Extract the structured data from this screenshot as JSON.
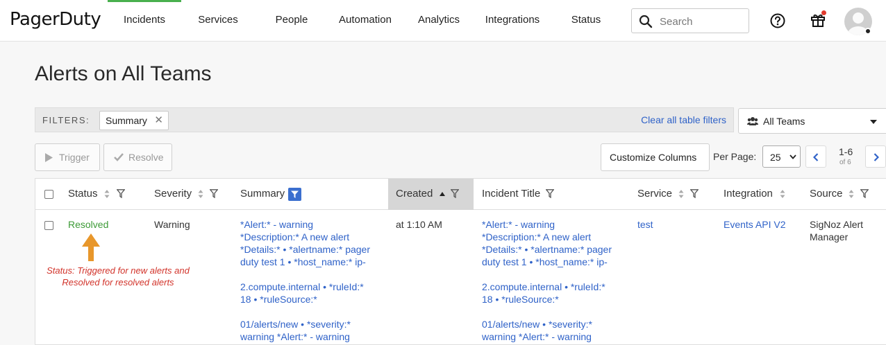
{
  "brand": "PagerDuty",
  "nav": {
    "items": [
      "Incidents",
      "Services",
      "People",
      "Automation",
      "Analytics",
      "Integrations",
      "Status"
    ],
    "active": "Incidents"
  },
  "search": {
    "placeholder": "Search"
  },
  "page_title": "Alerts on All Teams",
  "filters": {
    "label": "FILTERS:",
    "chip": "Summary",
    "clear_link": "Clear all table filters"
  },
  "team_select": "All Teams",
  "toolbar": {
    "trigger": "Trigger",
    "resolve": "Resolve",
    "customize": "Customize Columns",
    "per_page_label": "Per Page:",
    "per_page_value": "25",
    "range": "1-6",
    "of": "of 6"
  },
  "table": {
    "columns": [
      "Status",
      "Severity",
      "Summary",
      "Created",
      "Incident Title",
      "Service",
      "Integration",
      "Source"
    ],
    "row": {
      "status": "Resolved",
      "severity": "Warning",
      "summary_lines": [
        "*Alert:* - warning",
        "*Description:* A new alert",
        "*Details:* • *alertname:* pager",
        "duty test 1 • *host_name:* ip-",
        "",
        "2.compute.internal • *ruleId:*",
        "18 • *ruleSource:*",
        "",
        "01/alerts/new • *severity:*",
        "warning *Alert:* - warning"
      ],
      "created": "at 1:10 AM",
      "title_lines": [
        "*Alert:* - warning",
        "*Description:* A new alert",
        "*Details:* • *alertname:* pager",
        "duty test 1 • *host_name:* ip-",
        "",
        "2.compute.internal • *ruleId:*",
        "18 • *ruleSource:*",
        "",
        "01/alerts/new • *severity:*",
        "warning *Alert:* - warning"
      ],
      "service": "test",
      "integration": "Events API V2",
      "source_lines": [
        "SigNoz Alert",
        "Manager"
      ]
    }
  },
  "annotation": {
    "line1": "Status: Triggered  for new alerts and",
    "line2": "Resolved for resolved alerts",
    "color": "#d2332a",
    "arrow_color": "#e8972b"
  },
  "colors": {
    "link": "#2f62c8",
    "resolved": "#3c9a36",
    "nav_active": "#49b04e"
  }
}
